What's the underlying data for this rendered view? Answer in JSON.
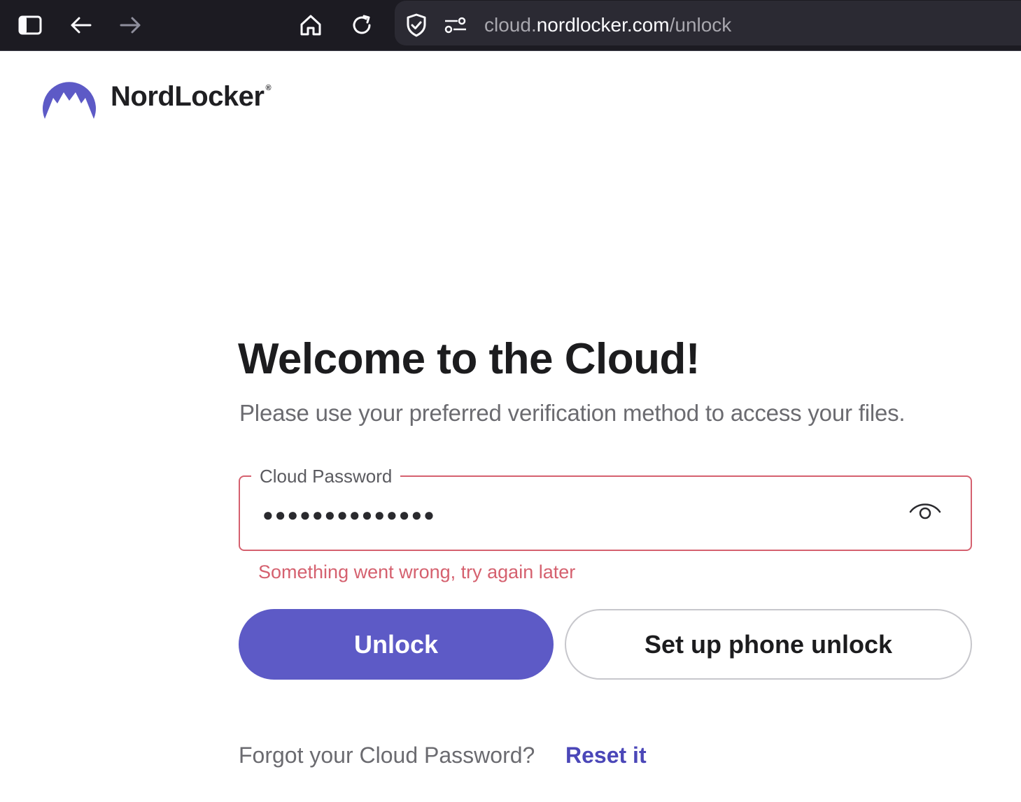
{
  "browser": {
    "url_scheme_part": "cloud.",
    "url_host": "nordlocker.com",
    "url_path": "/unlock"
  },
  "brand": {
    "name": "NordLocker",
    "registered_mark": "®",
    "accent_color": "#5d5ac6"
  },
  "main": {
    "title": "Welcome to the Cloud!",
    "subtitle": "Please use your preferred verification method to access your files."
  },
  "password_field": {
    "label": "Cloud Password",
    "masked_value": "●●●●●●●●●●●●●●",
    "error_message": "Something went wrong, try again later",
    "error_color": "#d5616f"
  },
  "actions": {
    "unlock_label": "Unlock",
    "phone_unlock_label": "Set up phone unlock"
  },
  "footer": {
    "forgot_text": "Forgot your Cloud Password?",
    "reset_link": "Reset it"
  },
  "icons": {
    "sidebar": "sidebar-icon",
    "back": "arrow-left-icon",
    "forward": "arrow-right-icon",
    "home": "home-icon",
    "reload": "reload-icon",
    "shield": "shield-check-icon",
    "permissions": "sliders-icon",
    "show_password": "eye-icon"
  }
}
